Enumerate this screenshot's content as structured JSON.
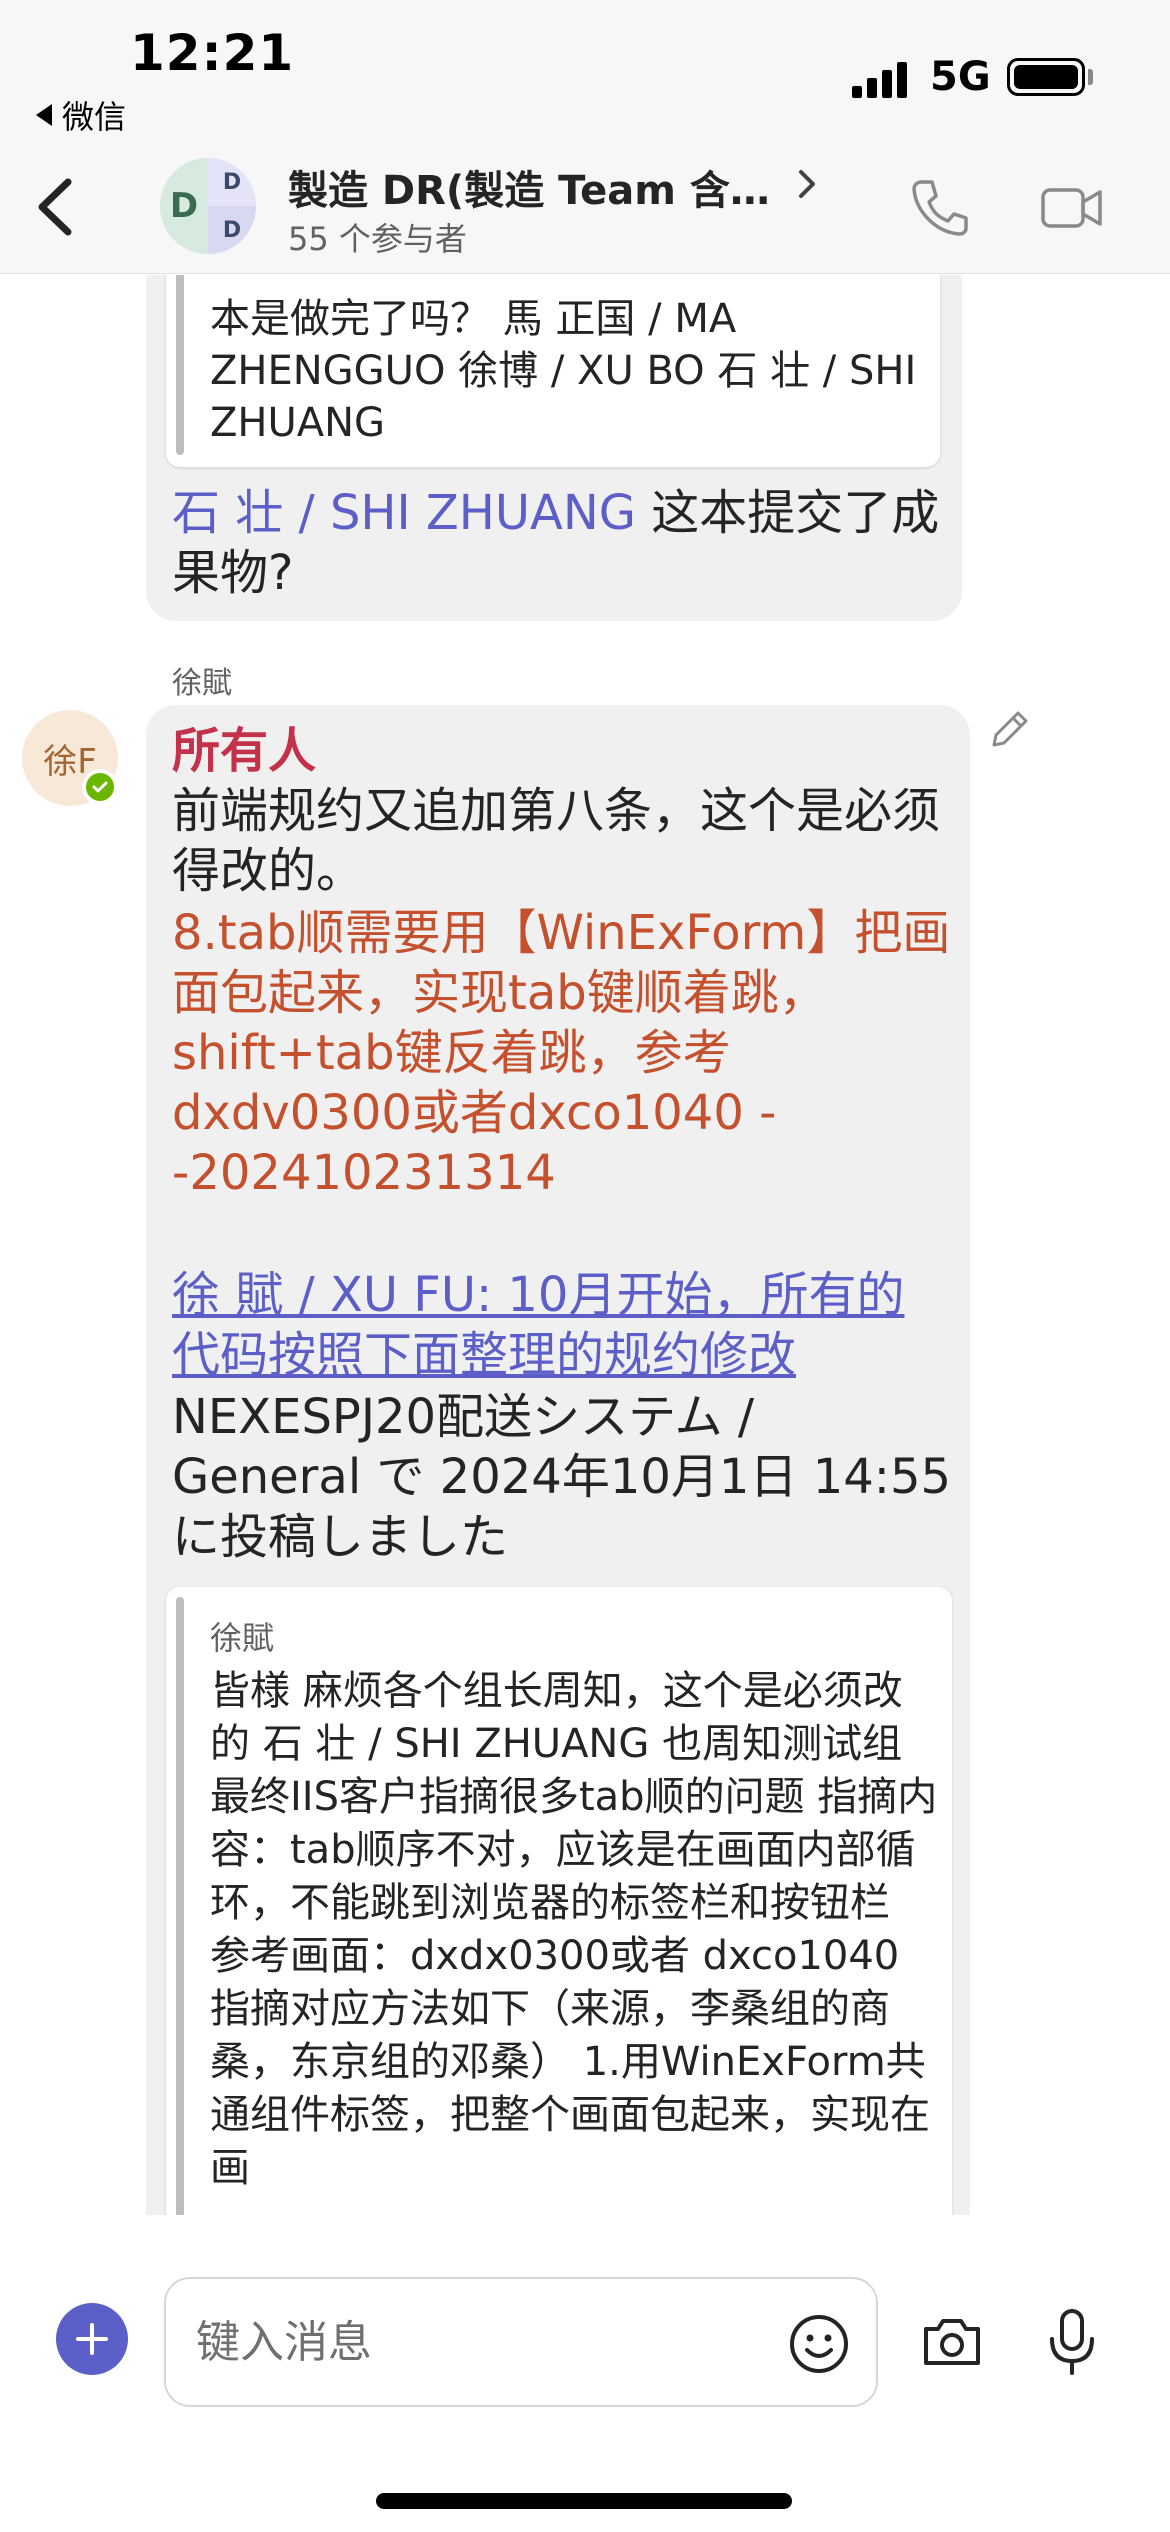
{
  "status_bar": {
    "time": "12:21",
    "back_app": "微信",
    "network": "5G"
  },
  "header": {
    "title": "製造 DR(製造 Team 含…",
    "participants": "55 个参与者",
    "avatar_initials": {
      "main": "D",
      "top_right": "D",
      "bottom_right": "D"
    }
  },
  "messages": [
    {
      "quote": {
        "text": "本是做完了吗？ 馬 正国 / MA ZHENGGUO 徐博 / XU BO 石 壮 / SHI ZHUANG"
      },
      "mention": "石 壮 / SHI ZHUANG",
      "text": " 这本提交了成果物?"
    },
    {
      "sender": "徐賦",
      "avatar_initials": "徐F",
      "mention_everyone": "所有人",
      "line": "前端规约又追加第八条，这个是必须得改的。",
      "highlight": "8.tab顺需要用【WinExForm】把画面包起来，实现tab键顺着跳，shift+tab键反着跳，参考dxdv0300或者dxco1040 --202410231314",
      "link": "徐 賦 / XU FU: 10月开始，所有的代码按照下面整理的规约修改",
      "post_note": "NEXESPJ20配送システム / General で 2024年10月1日 14:55 に投稿しました",
      "quote": {
        "author": "徐賦",
        "text": "皆様 麻烦各个组长周知，这个是必须改的 石 壮 / SHI ZHUANG 也周知测试组 最终IIS客户指摘很多tab顺的问题 指摘内容：tab顺序不对，应该是在画面内部循环，不能跳到浏览器的标签栏和按钮栏 参考画面：dxdx0300或者 dxco1040 指摘对应方法如下（来源，李桑组的商桑，东京组的邓桑） 1.用WinExForm共通组件标签，把整个画面包起来，实现在画"
      }
    }
  ],
  "compose": {
    "placeholder": "键入消息"
  },
  "colors": {
    "accent": "#5b5fc7",
    "mention_everyone": "#c4314b",
    "highlight_text": "#c4502d",
    "bubble_bg": "#f0f0f0",
    "presence": "#6bb700"
  },
  "icons": [
    "back-arrow-icon",
    "chevron-right-icon",
    "phone-icon",
    "video-icon",
    "edit-icon",
    "presence-check-icon",
    "add-icon",
    "emoji-icon",
    "camera-icon",
    "mic-icon"
  ]
}
